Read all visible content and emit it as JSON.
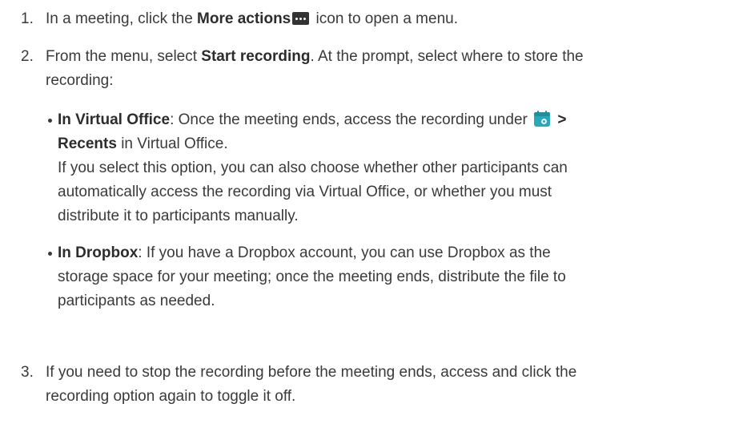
{
  "steps": [
    {
      "number": "1.",
      "pre": "In a meeting, click the ",
      "bold": "More actions",
      "icon": "more-actions-icon",
      "post": " icon to open a menu."
    },
    {
      "number": "2.",
      "pre": "From the menu, select ",
      "bold": "Start recording",
      "post_line1": ". At the prompt, select where to store the",
      "post_line2": "recording:",
      "bullets": [
        {
          "bold": "In Virtual Office",
          "line1_pre": ": Once the meeting ends, access the recording under ",
          "icon": "calendar-icon",
          "line1_post": " >",
          "line2_bold": "Recents",
          "line2_post": " in Virtual Office.",
          "extra_lines": [
            "If you select this option, you can also choose whether other participants can",
            "automatically access the recording via Virtual Office, or whether you must",
            "distribute it to participants manually."
          ]
        },
        {
          "bold": "In Dropbox",
          "line1_post": ": If you have a Dropbox account, you can use Dropbox as the",
          "extra_lines": [
            "storage space for your meeting; once the meeting ends, distribute the file to",
            "participants as needed."
          ]
        }
      ]
    },
    {
      "number": "3.",
      "lines": [
        "If you need to stop the recording before the meeting ends, access and click the",
        "recording option again to toggle it off."
      ]
    }
  ],
  "colors": {
    "text": "#3a3a3a",
    "icon_dark": "#333333",
    "icon_teal": "#2aa7b8"
  }
}
